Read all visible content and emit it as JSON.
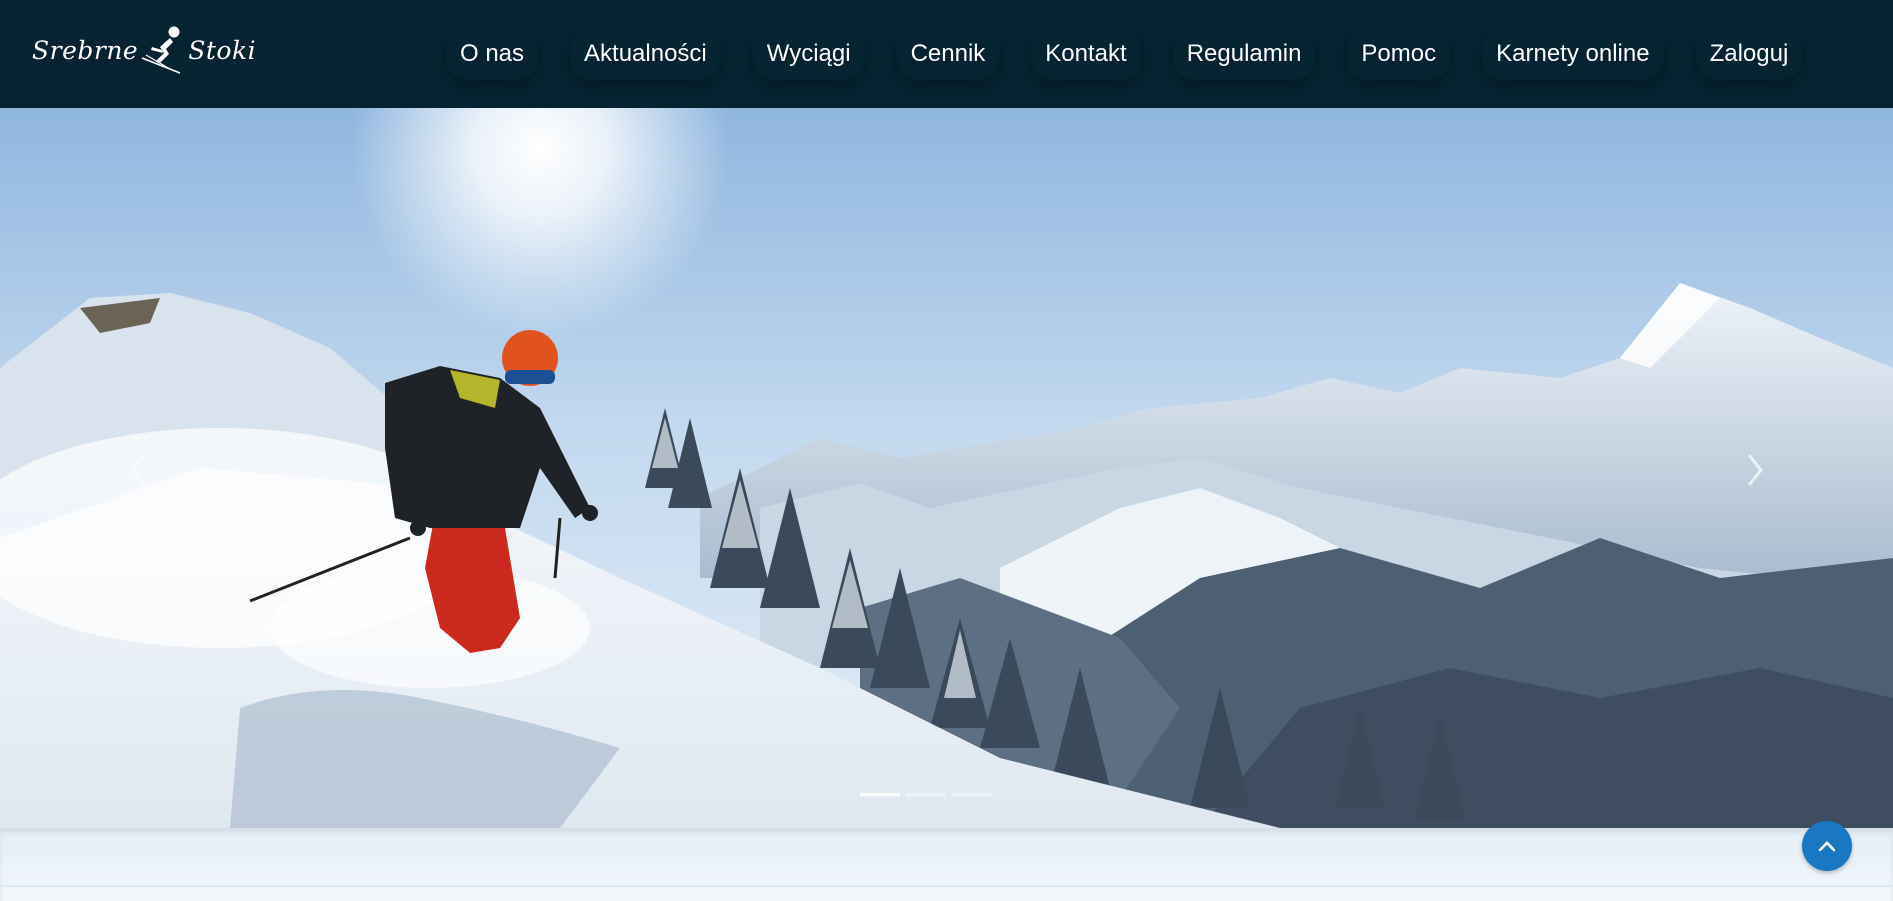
{
  "brand": {
    "word_left": "Srebrne",
    "word_right": "Stoki",
    "icon": "skier-icon"
  },
  "nav": {
    "items": [
      {
        "label": "O nas"
      },
      {
        "label": "Aktualności"
      },
      {
        "label": "Wyciągi"
      },
      {
        "label": "Cennik"
      },
      {
        "label": "Kontakt"
      },
      {
        "label": "Regulamin"
      },
      {
        "label": "Pomoc"
      },
      {
        "label": "Karnety online"
      },
      {
        "label": "Zaloguj"
      }
    ]
  },
  "carousel": {
    "prev_icon": "chevron-left-icon",
    "next_icon": "chevron-right-icon",
    "slide_count": 3,
    "active_index": 0
  },
  "scroll_top": {
    "icon": "chevron-up-icon"
  },
  "colors": {
    "navbar": "#052331",
    "accent": "#1a78c2",
    "nav_text": "#ffffff"
  }
}
